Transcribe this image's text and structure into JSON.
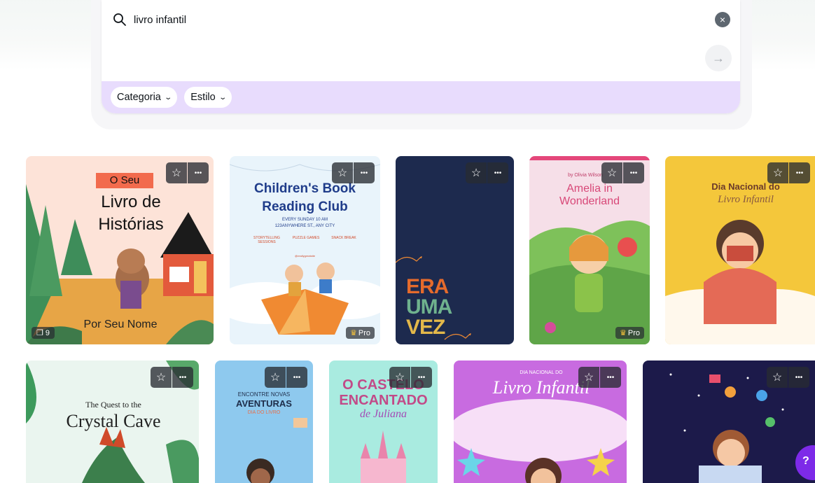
{
  "search": {
    "query": "livro infantil",
    "clear_icon": "×",
    "submit_icon": "→"
  },
  "filters": [
    {
      "label": "Categoria"
    },
    {
      "label": "Estilo"
    }
  ],
  "cards": [
    {
      "title_line1": "O Seu",
      "title_line2": "Livro de",
      "title_line3": "Histórias",
      "byline": "Por Seu Nome",
      "page_count": "9"
    },
    {
      "title_line1": "Children's Book",
      "title_line2": "Reading Club",
      "subtitle": "EVERY SUNDAY 10 AM",
      "address": "123ANYWHERE ST., ANY CITY",
      "items": [
        "STORYTELLING SESSIONS",
        "PUZZLE GAMES",
        "SNACK BREAK"
      ],
      "handle": "@reallygreatsite",
      "badge": "Pro"
    },
    {
      "lines": [
        "ERA",
        "UMA",
        "VEZ"
      ]
    },
    {
      "byline": "by Olivia Wilson",
      "title": "Amelia in Wonderland",
      "badge": "Pro"
    },
    {
      "title_line1": "Dia Nacional do",
      "title_line2": "Livro Infantil"
    },
    {
      "title_line1": "The Quest to the",
      "title_line2": "Crystal Cave"
    },
    {
      "kicker": "ENCONTRE NOVAS",
      "title": "AVENTURAS",
      "sub": "DIA DO LIVRO"
    },
    {
      "title_line1": "O CASTELO",
      "title_line2": "ENCANTADO",
      "title_line3": "de Juliana"
    },
    {
      "kicker": "DIA NACIONAL DO",
      "title": "Livro Infantil"
    },
    {}
  ],
  "card_actions": {
    "star_icon": "☆",
    "more_icon": "•••"
  },
  "pro_crown_icon": "♛",
  "help": {
    "label": "?"
  },
  "colors": {
    "accent_purple": "#7d2ae8",
    "filter_bar": "#e8dcfd"
  }
}
